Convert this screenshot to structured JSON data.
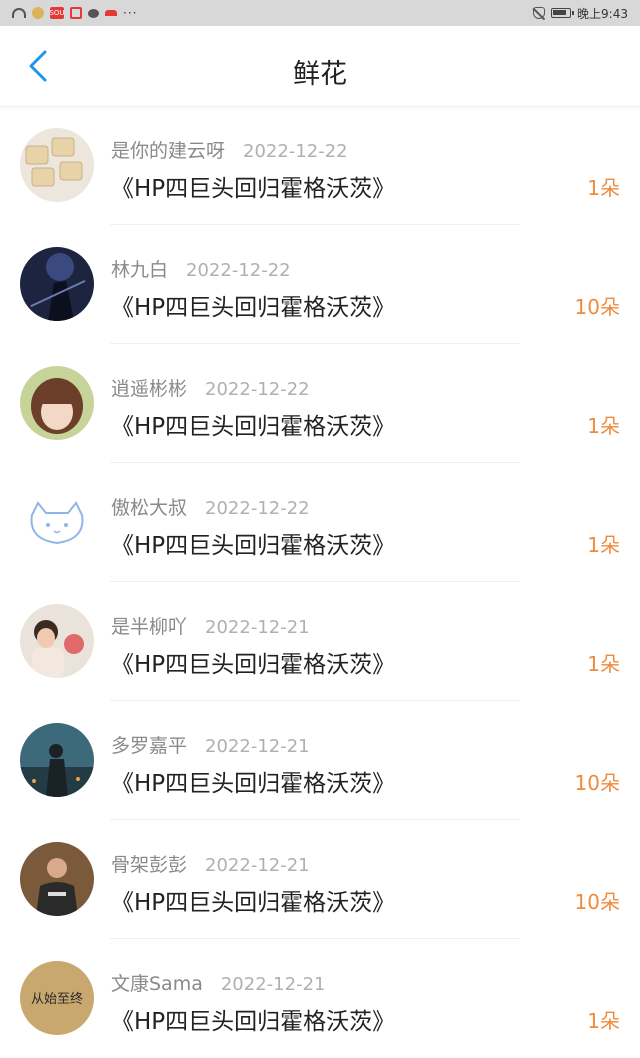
{
  "status": {
    "time": "晚上9:43",
    "more": "···",
    "app_badge": "SOU"
  },
  "header": {
    "title": "鲜花"
  },
  "rows": [
    {
      "name": "是你的建云呀",
      "date": "2022-12-22",
      "work": "《HP四巨头回归霍格沃茨》",
      "count": "1朵"
    },
    {
      "name": "林九白",
      "date": "2022-12-22",
      "work": "《HP四巨头回归霍格沃茨》",
      "count": "10朵"
    },
    {
      "name": "逍遥彬彬",
      "date": "2022-12-22",
      "work": "《HP四巨头回归霍格沃茨》",
      "count": "1朵"
    },
    {
      "name": "傲松大叔",
      "date": "2022-12-22",
      "work": "《HP四巨头回归霍格沃茨》",
      "count": "1朵"
    },
    {
      "name": "是半柳吖",
      "date": "2022-12-21",
      "work": "《HP四巨头回归霍格沃茨》",
      "count": "1朵"
    },
    {
      "name": "多罗嘉平",
      "date": "2022-12-21",
      "work": "《HP四巨头回归霍格沃茨》",
      "count": "10朵"
    },
    {
      "name": "骨架彭彭",
      "date": "2022-12-21",
      "work": "《HP四巨头回归霍格沃茨》",
      "count": "10朵"
    },
    {
      "name": "文康Sama",
      "date": "2022-12-21",
      "work": "《HP四巨头回归霍格沃茨》",
      "count": "1朵",
      "avatar_text": "从始至终"
    }
  ],
  "colors": {
    "accent": "#1e96e8",
    "count": "#f08a3c"
  }
}
